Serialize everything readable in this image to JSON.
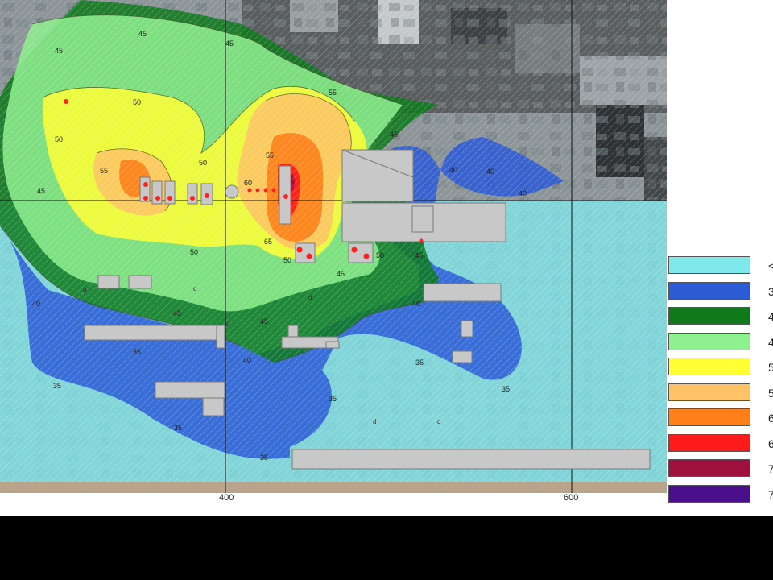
{
  "map": {
    "axis": {
      "x_ticks": [
        "400",
        "600"
      ]
    },
    "caption": "...",
    "contour_labels": [
      "45",
      "45",
      "45",
      "50",
      "50",
      "50",
      "50",
      "50",
      "55",
      "55",
      "55",
      "60",
      "65",
      "45",
      "40",
      "40",
      "40",
      "40",
      "40",
      "45",
      "45",
      "45",
      "40",
      "45",
      "35",
      "35",
      "35",
      "35",
      "35",
      "35",
      "35",
      "50",
      "45"
    ],
    "mini_labels": [
      "d",
      "d",
      "d",
      "d",
      "d",
      "d"
    ]
  },
  "legend": {
    "items": [
      {
        "color": "#7fe8ea",
        "label": "<"
      },
      {
        "color": "#2d5bd6",
        "label": "3"
      },
      {
        "color": "#0e7a1c",
        "label": "4"
      },
      {
        "color": "#8ef08e",
        "label": "4"
      },
      {
        "color": "#ffff33",
        "label": "5"
      },
      {
        "color": "#ffc266",
        "label": "5"
      },
      {
        "color": "#ff7f1a",
        "label": "6"
      },
      {
        "color": "#ff1a1a",
        "label": "6"
      },
      {
        "color": "#a0103c",
        "label": "7"
      },
      {
        "color": "#4b0f8c",
        "label": "7"
      }
    ]
  }
}
